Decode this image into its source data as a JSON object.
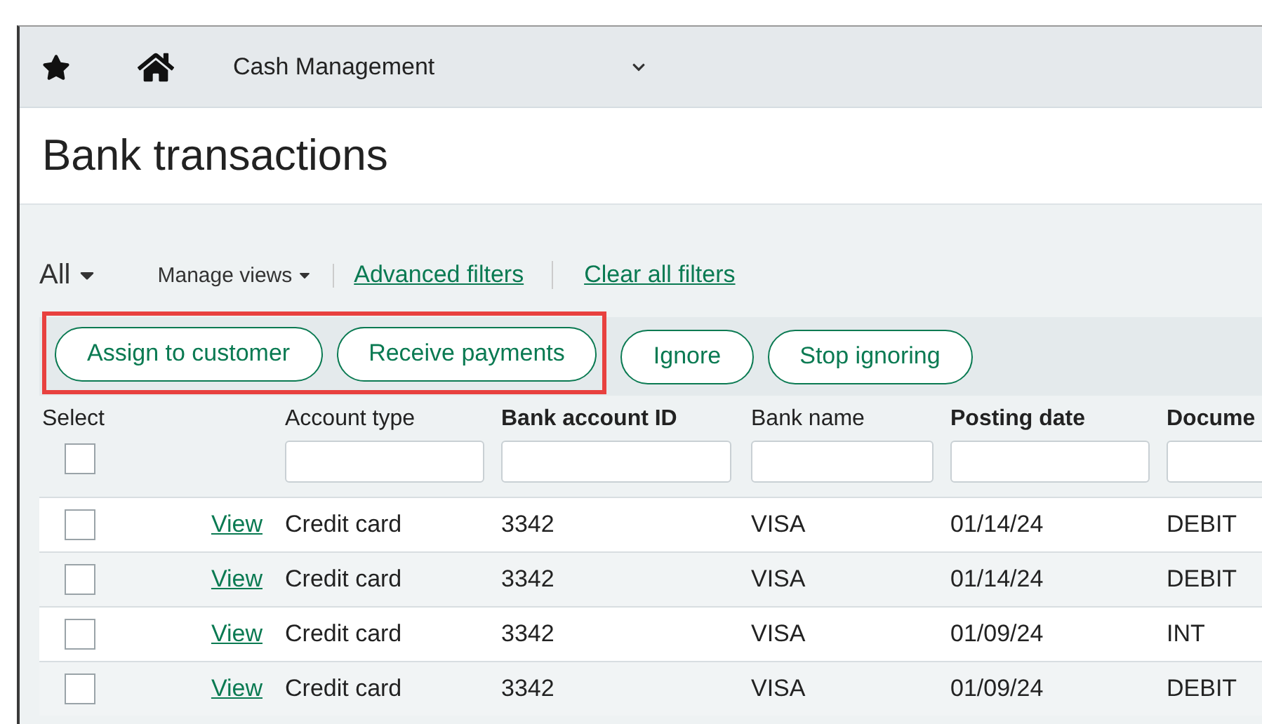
{
  "nav": {
    "module": "Cash Management"
  },
  "page_title": "Bank transactions",
  "filters": {
    "view": "All",
    "manage_views": "Manage views",
    "links": [
      "Advanced filters",
      "Clear all filters"
    ]
  },
  "action_buttons": [
    {
      "label": "Assign to customer",
      "highlighted": true
    },
    {
      "label": "Receive payments",
      "highlighted": true
    },
    {
      "label": "Ignore",
      "highlighted": false
    },
    {
      "label": "Stop ignoring",
      "highlighted": false
    }
  ],
  "table": {
    "select_label": "Select",
    "select_all_checked": false,
    "columns": [
      {
        "label": "Account type",
        "bold": false
      },
      {
        "label": "Bank account ID",
        "bold": true
      },
      {
        "label": "Bank name",
        "bold": false
      },
      {
        "label": "Posting date",
        "bold": true
      },
      {
        "label": "Docume",
        "bold": true
      }
    ],
    "rows": [
      {
        "checked": false,
        "link": "View",
        "cells": [
          "Credit card",
          "3342",
          "VISA",
          "01/14/24",
          "DEBIT"
        ]
      },
      {
        "checked": false,
        "link": "View",
        "cells": [
          "Credit card",
          "3342",
          "VISA",
          "01/14/24",
          "DEBIT"
        ]
      },
      {
        "checked": false,
        "link": "View",
        "cells": [
          "Credit card",
          "3342",
          "VISA",
          "01/09/24",
          "INT"
        ]
      },
      {
        "checked": false,
        "link": "View",
        "cells": [
          "Credit card",
          "3342",
          "VISA",
          "01/09/24",
          "DEBIT"
        ]
      }
    ]
  }
}
